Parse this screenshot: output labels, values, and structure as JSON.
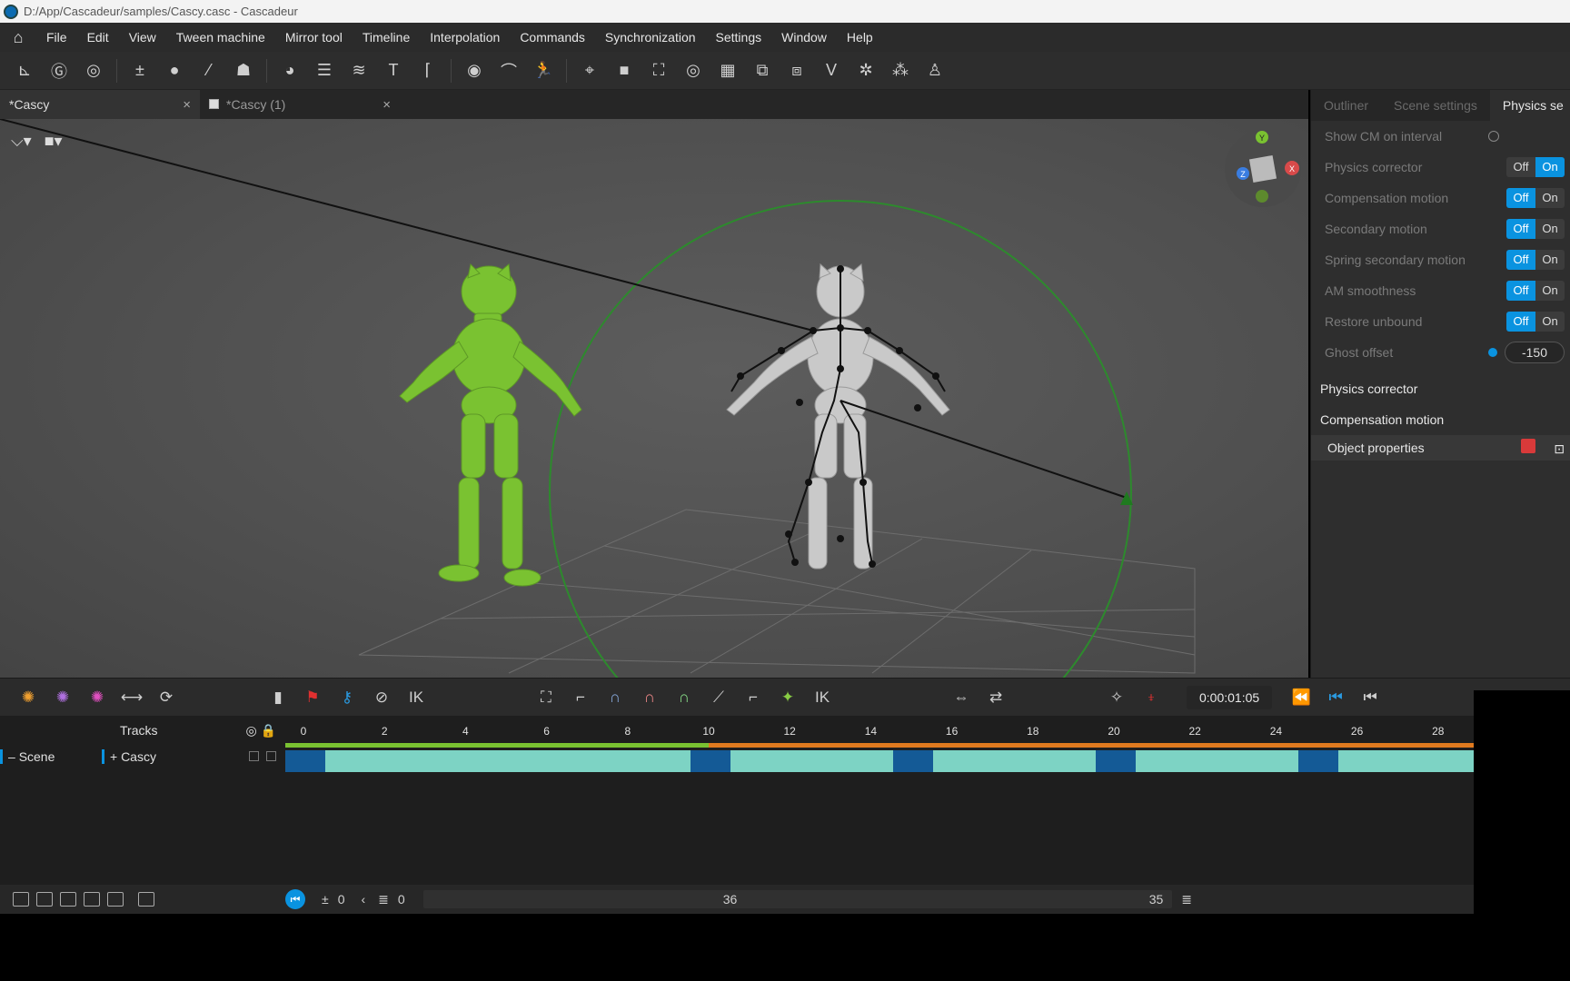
{
  "window": {
    "title": "D:/App/Cascadeur/samples/Cascy.casc - Cascadeur"
  },
  "menu": [
    "File",
    "Edit",
    "View",
    "Tween machine",
    "Mirror tool",
    "Timeline",
    "Interpolation",
    "Commands",
    "Synchronization",
    "Settings",
    "Window",
    "Help"
  ],
  "doc_tabs": [
    {
      "label": "*Cascy",
      "close": "×"
    },
    {
      "label": "*Cascy (1)",
      "close": "×"
    }
  ],
  "panel": {
    "tabs": [
      "Outliner",
      "Scene settings",
      "Physics se"
    ],
    "rows": [
      {
        "label": "Show CM on interval",
        "type": "radio"
      },
      {
        "label": "Physics corrector",
        "type": "toggle",
        "value": "On"
      },
      {
        "label": "Compensation motion",
        "type": "toggle",
        "value": "Off"
      },
      {
        "label": "Secondary motion",
        "type": "toggle",
        "value": "Off"
      },
      {
        "label": "Spring secondary motion",
        "type": "toggle",
        "value": "Off"
      },
      {
        "label": "AM smoothness",
        "type": "toggle",
        "value": "Off"
      },
      {
        "label": "Restore unbound",
        "type": "toggle",
        "value": "Off"
      },
      {
        "label": "Ghost offset",
        "type": "number",
        "value": "-150"
      }
    ],
    "toggle_off": "Off",
    "toggle_on": "On",
    "section_physics": "Physics corrector",
    "section_compensation": "Compensation motion",
    "object_properties": "Object properties"
  },
  "timeline": {
    "time": "0:00:01:05",
    "tracks_label": "Tracks",
    "scene_label": "Scene",
    "cascy_label": "+ Cascy",
    "ruler_ticks": [
      "0",
      "2",
      "4",
      "6",
      "8",
      "10",
      "12",
      "14",
      "16",
      "18",
      "20",
      "22",
      "24",
      "26",
      "28"
    ],
    "interval_start": "0",
    "current_frame": "0",
    "total_frames": "36",
    "end_frame": "35"
  },
  "colors": {
    "accent": "#0a93e0",
    "green_character": "#7ac231",
    "key_dark": "#145a96",
    "interval_teal": "#7dd3c4",
    "physics_line_orange": "#e07a1f",
    "physics_line_green": "#7ac231"
  }
}
